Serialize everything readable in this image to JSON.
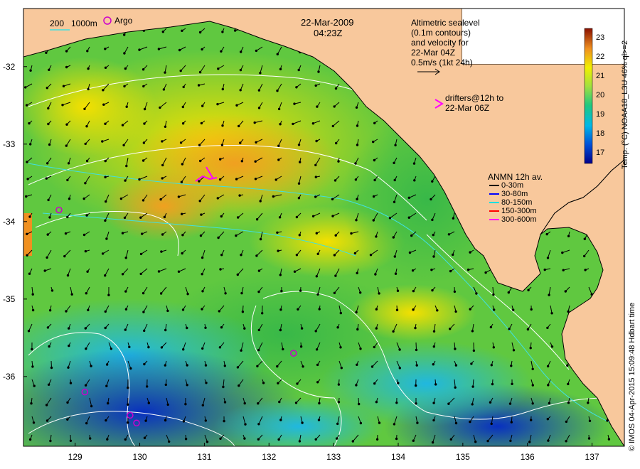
{
  "header": {
    "date": "22-Mar-2009",
    "time": "04:23Z"
  },
  "scale_legend": {
    "depth_200": "200",
    "depth_1000": "1000m",
    "argo_label": "Argo"
  },
  "altimetry_note": {
    "line1": "Altimetric sealevel",
    "line2": "(0.1m contours)",
    "line3": "and velocity for",
    "line4": "22-Mar 04Z",
    "line5": "0.5m/s (1kt 24h)"
  },
  "drifters_note": {
    "line1": "drifters@12h to",
    "line2": "22-Mar 06Z"
  },
  "anmn_legend": {
    "title": "ANMN 12h av.",
    "items": [
      {
        "label": "0-30m",
        "color": "#000000"
      },
      {
        "label": "30-80m",
        "color": "#0000ff"
      },
      {
        "label": "80-150m",
        "color": "#00e0e0"
      },
      {
        "label": "150-300m",
        "color": "#ff0000"
      },
      {
        "label": "300-600m",
        "color": "#ff00ff"
      }
    ]
  },
  "colorbar": {
    "title": "Temp. (°C) NOAA18_L3U 46% ql>=2",
    "ticks": [
      "23",
      "22",
      "21",
      "20",
      "19",
      "18",
      "17"
    ],
    "range": [
      16.5,
      23.5
    ]
  },
  "credit": "© IMOS 04-Apr-2015 15:09:48 Hdbart time",
  "axes": {
    "lat_ticks": [
      "-32",
      "-33",
      "-34",
      "-35",
      "-36"
    ],
    "lon_ticks": [
      "129",
      "130",
      "131",
      "132",
      "133",
      "134",
      "135",
      "136",
      "137"
    ],
    "lon_range": [
      128.2,
      137.5
    ],
    "lat_range": [
      -31.25,
      -36.9
    ]
  },
  "argo_floats": [
    {
      "lon": 128.75,
      "lat": -33.85
    },
    {
      "lon": 132.38,
      "lat": -35.7
    },
    {
      "lon": 129.15,
      "lat": -36.2
    },
    {
      "lon": 129.85,
      "lat": -36.5
    },
    {
      "lon": 129.95,
      "lat": -36.6
    }
  ],
  "colors": {
    "land": "#f8c89c",
    "coast": "#000000",
    "contour": "#ffffff",
    "argo": "#cc00cc",
    "drifter": "#ff00ff"
  }
}
